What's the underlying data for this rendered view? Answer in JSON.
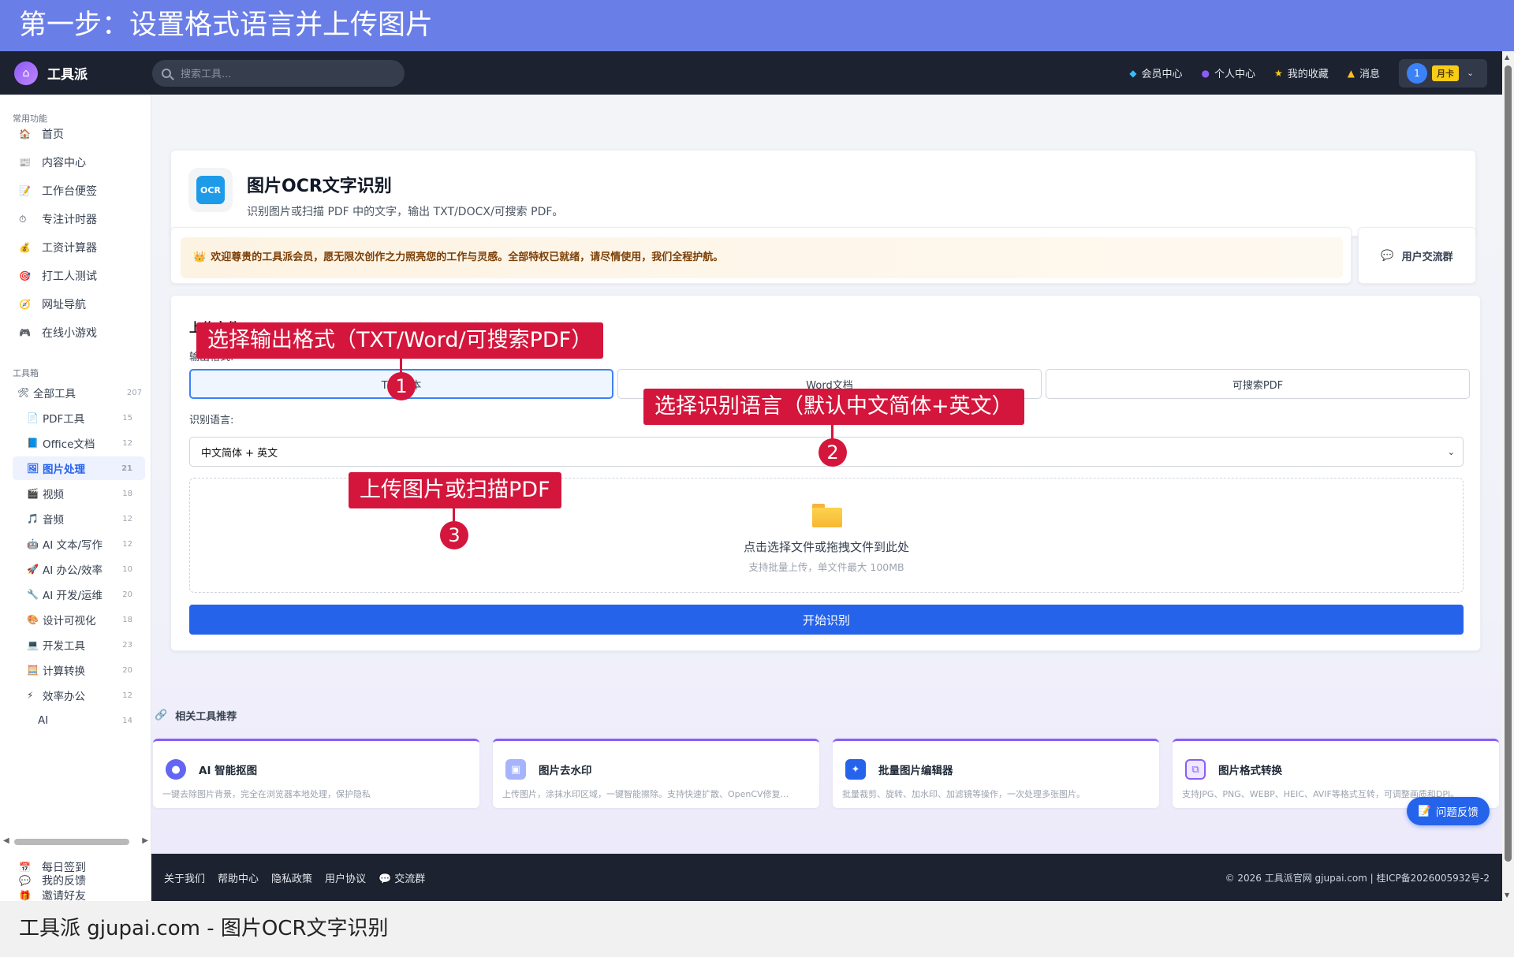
{
  "banner": {
    "title": "第一步：设置格式语言并上传图片"
  },
  "caption": {
    "text": "工具派 gjupai.com - 图片OCR文字识别"
  },
  "topbar": {
    "logo_text": "工具派",
    "search_placeholder": "搜索工具...",
    "links": [
      {
        "label": "会员中心",
        "icon": "diamond-icon"
      },
      {
        "label": "个人中心",
        "icon": "user-icon"
      },
      {
        "label": "我的收藏",
        "icon": "star-icon"
      },
      {
        "label": "消息",
        "icon": "bell-icon"
      }
    ],
    "user": {
      "avatar": "1",
      "badge": "月卡"
    }
  },
  "sidebar": {
    "common_title": "常用功能",
    "common": [
      {
        "label": "首页",
        "icon": "🏠"
      },
      {
        "label": "内容中心",
        "icon": "📰"
      },
      {
        "label": "工作台便签",
        "icon": "📝"
      },
      {
        "label": "专注计时器",
        "icon": "⏱"
      },
      {
        "label": "工资计算器",
        "icon": "💰"
      },
      {
        "label": "打工人测试",
        "icon": "🎯"
      },
      {
        "label": "网址导航",
        "icon": "🧭"
      },
      {
        "label": "在线小游戏",
        "icon": "🎮"
      }
    ],
    "toolbox_title": "工具箱",
    "all_tools": {
      "label": "全部工具",
      "count": "207"
    },
    "categories": [
      {
        "label": "PDF工具",
        "count": "15",
        "icon": "📄"
      },
      {
        "label": "Office文档",
        "count": "12",
        "icon": "📘"
      },
      {
        "label": "图片处理",
        "count": "21",
        "icon": "🖼"
      },
      {
        "label": "视频",
        "count": "18",
        "icon": "🎬"
      },
      {
        "label": "音频",
        "count": "12",
        "icon": "🎵"
      },
      {
        "label": "AI 文本/写作",
        "count": "12",
        "icon": "🤖"
      },
      {
        "label": "AI 办公/效率",
        "count": "10",
        "icon": "🚀"
      },
      {
        "label": "AI 开发/运维",
        "count": "20",
        "icon": "🔧"
      },
      {
        "label": "设计可视化",
        "count": "18",
        "icon": "🎨"
      },
      {
        "label": "开发工具",
        "count": "23",
        "icon": "💻"
      },
      {
        "label": "计算转换",
        "count": "20",
        "icon": "🧮"
      },
      {
        "label": "效率办公",
        "count": "12",
        "icon": "⚡"
      },
      {
        "label": "AI",
        "count": "14",
        "icon": ""
      }
    ],
    "bottom": [
      {
        "label": "每日签到",
        "icon": "📅"
      },
      {
        "label": "邀请好友",
        "icon": "🎁"
      },
      {
        "label": "我的反馈",
        "icon": "💬"
      }
    ]
  },
  "tool": {
    "badge": "OCR",
    "title": "图片OCR文字识别",
    "subtitle": "识别图片或扫描 PDF 中的文字，输出 TXT/DOCX/可搜索 PDF。"
  },
  "welcome": {
    "text": "欢迎尊贵的工具派会员，愿无限次创作之力照亮您的工作与灵感。全部特权已就绪，请尽情使用，我们全程护航。",
    "group_label": "用户交流群"
  },
  "upload": {
    "section_title": "上传文件",
    "format_label": "输出格式:",
    "formats": [
      "TXT文本",
      "Word文档",
      "可搜索PDF"
    ],
    "lang_label": "识别语言:",
    "lang_value": "中文简体 + 英文",
    "drop_main": "点击选择文件或拖拽文件到此处",
    "drop_sub": "支持批量上传，单文件最大 100MB",
    "start_label": "开始识别"
  },
  "related": {
    "title": "相关工具推荐",
    "items": [
      {
        "name": "AI 智能抠图",
        "desc": "一键去除图片背景，完全在浏览器本地处理，保护隐私",
        "color": "#6366f1"
      },
      {
        "name": "图片去水印",
        "desc": "上传图片，涂抹水印区域，一键智能擦除。支持快速扩散、OpenCV修复...",
        "color": "#a5b4fc"
      },
      {
        "name": "批量图片编辑器",
        "desc": "批量裁剪、旋转、加水印、加滤镜等操作，一次处理多张图片。",
        "color": "#2563eb"
      },
      {
        "name": "图片格式转换",
        "desc": "支持JPG、PNG、WEBP、HEIC、AVIF等格式互转，可调整画质和DPI。",
        "color": "#8b5cf6"
      }
    ]
  },
  "feedback_label": "问题反馈",
  "footer": {
    "links": [
      "关于我们",
      "帮助中心",
      "隐私政策",
      "用户协议",
      "交流群"
    ],
    "copyright": "© 2026 工具派官网 gjupai.com | 桂ICP备2026005932号-2"
  },
  "annotations": [
    {
      "text": "选择输出格式（TXT/Word/可搜索PDF）",
      "number": "1"
    },
    {
      "text": "选择识别语言（默认中文简体+英文）",
      "number": "2"
    },
    {
      "text": "上传图片或扫描PDF",
      "number": "3"
    }
  ]
}
